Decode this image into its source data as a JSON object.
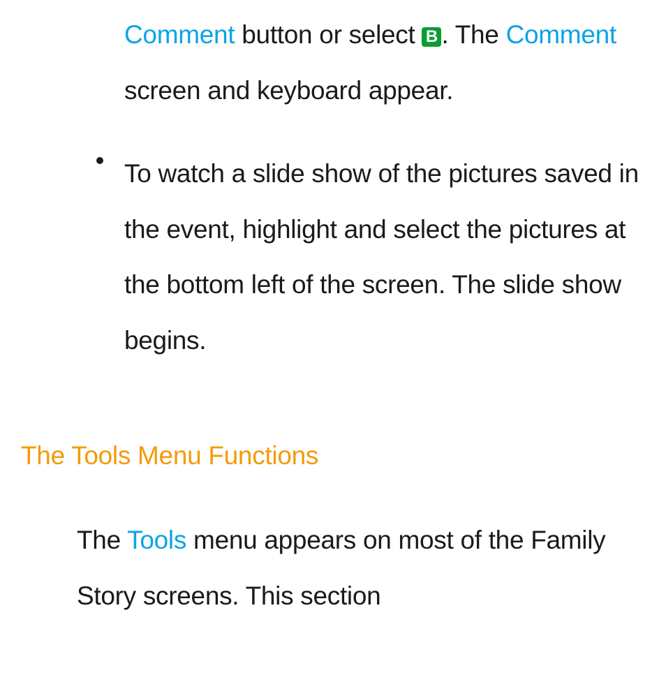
{
  "list": {
    "item1": {
      "link1": "Comment",
      "text1": " button or select ",
      "button_icon": "B",
      "text2": ". The ",
      "link2": "Comment",
      "text3": " screen and keyboard appear."
    },
    "item2": {
      "text": "To watch a slide show of the pictures saved in the event, highlight and select the pictures at the bottom left of the screen. The slide show begins."
    }
  },
  "heading": "The Tools Menu Functions",
  "para": {
    "text1": "The ",
    "link1": "Tools",
    "text2": " menu appears on most of the Family Story screens. This section"
  }
}
